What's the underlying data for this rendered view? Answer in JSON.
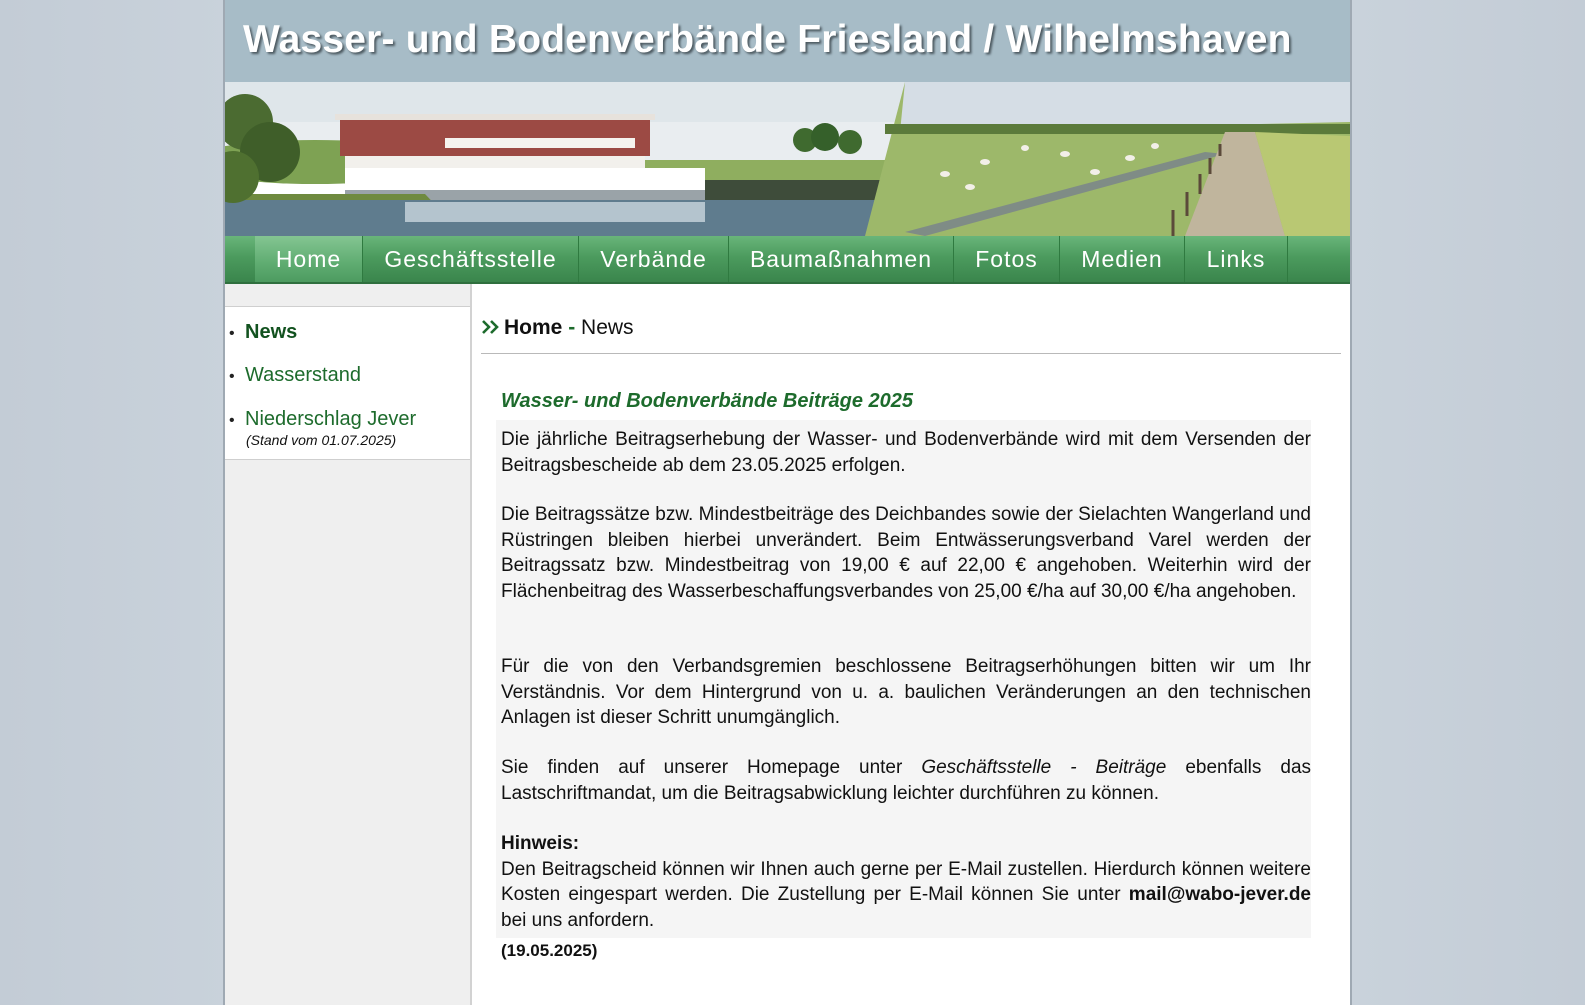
{
  "site": {
    "title": "Wasser- und Bodenverbände Friesland / Wilhelmshaven"
  },
  "nav": {
    "items": [
      {
        "label": "Home",
        "active": true
      },
      {
        "label": "Geschäftsstelle"
      },
      {
        "label": "Verbände"
      },
      {
        "label": "Baumaßnahmen"
      },
      {
        "label": "Fotos"
      },
      {
        "label": "Medien"
      },
      {
        "label": "Links"
      }
    ]
  },
  "sidebar": {
    "items": [
      {
        "label": "News",
        "active": true
      },
      {
        "label": "Wasserstand"
      },
      {
        "label": "Niederschlag Jever",
        "sub": "(Stand vom 01.07.2025)"
      }
    ]
  },
  "breadcrumb": {
    "home": "Home",
    "separator": "-",
    "current": "News"
  },
  "article": {
    "title": "Wasser- und Bodenverbände Beiträge 2025",
    "p1": "Die jährliche Beitragserhebung der Wasser- und Bodenverbände wird mit dem Versenden der Beitragsbescheide ab dem 23.05.2025 erfolgen.",
    "p2": "Die Beitragssätze bzw. Mindestbeiträge des Deichbandes sowie der Sielachten Wangerland und Rüstringen bleiben hierbei unverändert. Beim Entwässerungsverband Varel werden der Beitragssatz bzw. Mindestbeitrag von 19,00 € auf 22,00 € angehoben. Weiterhin wird der Flächenbeitrag des Wasserbeschaffungsverbandes von 25,00 €/ha auf 30,00 €/ha angehoben.",
    "p3": "Für die von den Verbandsgremien beschlossene Beitragserhöhungen bitten wir um Ihr Verständnis. Vor dem Hintergrund von u. a. baulichen Veränderungen an den technischen Anlagen ist dieser Schritt unumgänglich.",
    "p4_before": "Sie finden auf unserer Homepage unter",
    "p4_link": "Geschäftsstelle - Beiträge",
    "p4_after": "ebenfalls das Lastschriftmandat, um die Beitragsabwicklung leichter durchführen zu können.",
    "note_heading": "Hinweis:",
    "note_text": "Den Beitragscheid können wir Ihnen auch gerne per E-Mail zustellen. Hierdurch können weitere Kosten eingespart werden. Die Zustellung per E-Mail können Sie unter",
    "note_email": "mail@wabo-jever.de",
    "note_after": "bei uns anfordern.",
    "date": "(19.05.2025)"
  },
  "colors": {
    "accent_green": "#1d6b2c",
    "nav_green": "#4c9b5e",
    "banner": "#a7bcc7"
  }
}
